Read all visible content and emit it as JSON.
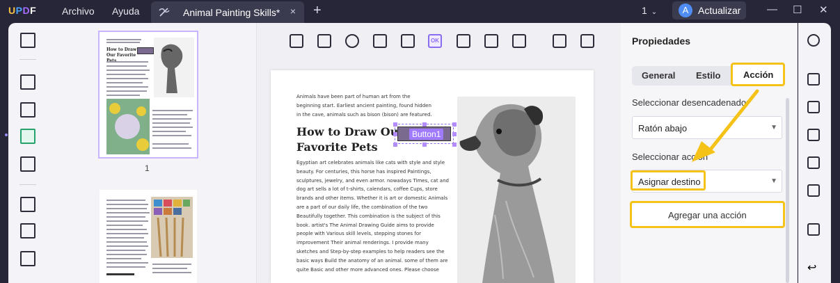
{
  "app": {
    "logo": {
      "u": "U",
      "p": "P",
      "d": "D",
      "f": "F"
    },
    "menu": [
      "Archivo",
      "Ayuda"
    ],
    "tab_title": "Animal Painting Skills*",
    "tab_close": "×",
    "new_tab": "+",
    "page_counter": "1",
    "update_label": "Actualizar",
    "avatar_letter": "A",
    "window_controls": {
      "minimize": "—",
      "maximize": "☐",
      "close": "✕"
    }
  },
  "thumbnails": {
    "page1_number": "1",
    "page1_heading": "How to Draw Our Favorite Pets"
  },
  "document": {
    "intro": "Animals have been part of human art from the beginning start. Earliest ancient painting, found hidden in the cave, animals such as bison (bison) are featured.",
    "heading_line1": "How to Draw Our",
    "heading_line2": "Favorite Pets",
    "body": "Egyptian art celebrates animals like cats with style and style beauty. For centuries, this horse has inspired Paintings, sculptures, jewelry, and even armor. nowadays Times, cat and dog art sells a lot of t-shirts, calendars, coffee Cups, store brands and other items. Whether it is art or domestic Animals are a part of our daily life, the combination of the two Beautifully together. This combination is the subject of this book. artist's The Animal Drawing Guide aims to provide people with Various skill levels, stepping stones for improvement Their animal renderings. I provide many sketches and Step-by-step examples to help readers see the basic ways Build the anatomy of an animal. some of them are quite Basic and other more advanced ones. Please choose",
    "button_label": "Button1"
  },
  "properties": {
    "title": "Propiedades",
    "tabs": [
      "General",
      "Estilo",
      "Acción"
    ],
    "active_tab": "Acción",
    "trigger_label": "Seleccionar desencadenador",
    "trigger_value": "Ratón abajo",
    "action_label": "Seleccionar acción",
    "action_value": "Asignar destino",
    "add_action_button": "Agregar una acción",
    "caret": "▼"
  },
  "colors": {
    "accent_yellow": "#f5c218",
    "accent_purple": "#8a6cf0",
    "active_green": "#25a36a",
    "titlebar": "#262638"
  }
}
